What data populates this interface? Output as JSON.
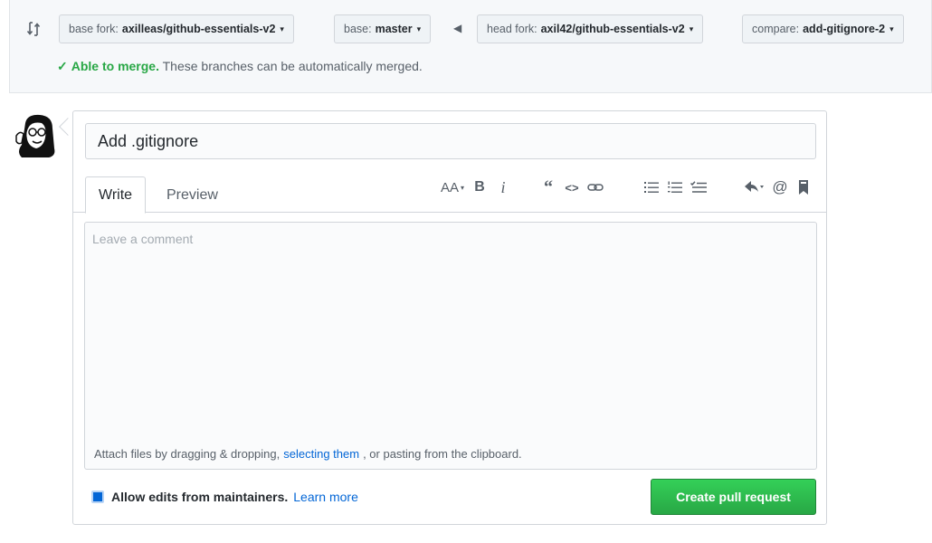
{
  "compare": {
    "base_fork_label": "base fork:",
    "base_fork_value": "axilleas/github-essentials-v2",
    "base_label": "base:",
    "base_value": "master",
    "head_fork_label": "head fork:",
    "head_fork_value": "axil42/github-essentials-v2",
    "compare_label": "compare:",
    "compare_value": "add-gitignore-2",
    "merge_ok": "Able to merge.",
    "merge_text": "These branches can be automatically merged."
  },
  "form": {
    "title_value": "Add .gitignore",
    "tabs": [
      {
        "label": "Write"
      },
      {
        "label": "Preview"
      }
    ],
    "toolbar": {
      "header": "AA",
      "bold": "B",
      "italic": "i",
      "quote": "“",
      "code": "<>"
    },
    "comment_placeholder": "Leave a comment",
    "attach_prefix": "Attach files by dragging & dropping,",
    "attach_link": "selecting them",
    "attach_suffix": ", or pasting from the clipboard.",
    "allow_edits_label": "Allow edits from maintainers.",
    "learn_more": "Learn more",
    "submit_label": "Create pull request"
  },
  "colors": {
    "primary_green": "#28a745",
    "link_blue": "#0366d6"
  }
}
